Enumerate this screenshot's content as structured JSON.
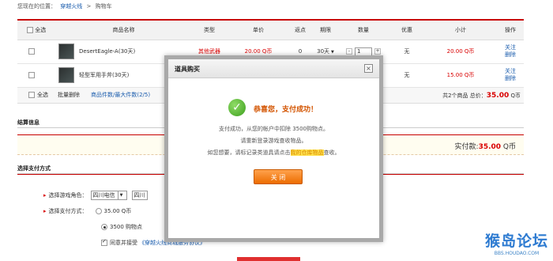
{
  "breadcrumb": {
    "prefix": "您现在的位置：",
    "items": [
      "穿越火线",
      ">",
      "购物车"
    ]
  },
  "cart": {
    "headers": [
      "全选",
      "商品名称",
      "类型",
      "单价",
      "返点",
      "期限",
      "数量",
      "优惠",
      "小计",
      "操作"
    ],
    "rows": [
      {
        "name": "DesertEagle-A(30天)",
        "type": "其他武器",
        "price": "20.00 Q币",
        "rebate": "0",
        "term": "30天",
        "qty": "1",
        "discount": "无",
        "subtotal": "20.00 Q币",
        "ops": [
          "关注",
          "删除"
        ]
      },
      {
        "name": "轻型军用手斧(30天)",
        "type": "",
        "price": "",
        "rebate": "",
        "term": "",
        "qty": "1",
        "discount": "无",
        "subtotal": "15.00 Q币",
        "ops": [
          "关注",
          "删除"
        ]
      }
    ],
    "footer": {
      "select_all": "全选",
      "batch_delete": "批量删除",
      "count_link": "商品件数/最大件数(2/5)",
      "summary_prefix": "共2个商品 总价：",
      "summary_total": "35.00",
      "summary_unit": "Q币"
    },
    "minus": "-",
    "plus": "+"
  },
  "settle": {
    "title": "结算信息",
    "total_label": "实付款:",
    "total_value": "35.00",
    "total_unit": "Q币"
  },
  "pay": {
    "title": "选择支付方式",
    "role_label": "选择游戏角色：",
    "role_value": "四川电信",
    "role_value2": "四川",
    "method_label": "选择支付方式：",
    "option1": "35.00 Q币",
    "option2": "3500 购物点",
    "agree_label": "同意并接受",
    "agree_link": "《穿越火线商城服务协议》"
  },
  "dialog": {
    "title": "道具购买",
    "close_x": "×",
    "success": "恭喜您，支付成功！",
    "line1": "支付成功，从您的帐户中扣除 3500购物点。",
    "line2": "请重新登录游戏查收物品。",
    "line3_pre": "如您想要，请标记录类道具请点击",
    "line3_hl": "我的仓库物品",
    "line3_post": "查收。",
    "button": "关 闭"
  },
  "watermark": {
    "big": "猴岛论坛",
    "small": "BBS.HOUDAO.COM"
  },
  "colors": {
    "accent_red": "#c80000",
    "price_red": "#d90000",
    "success_orange": "#d35400",
    "button_orange": "#ec6c00",
    "link_blue": "#1a5cad"
  }
}
